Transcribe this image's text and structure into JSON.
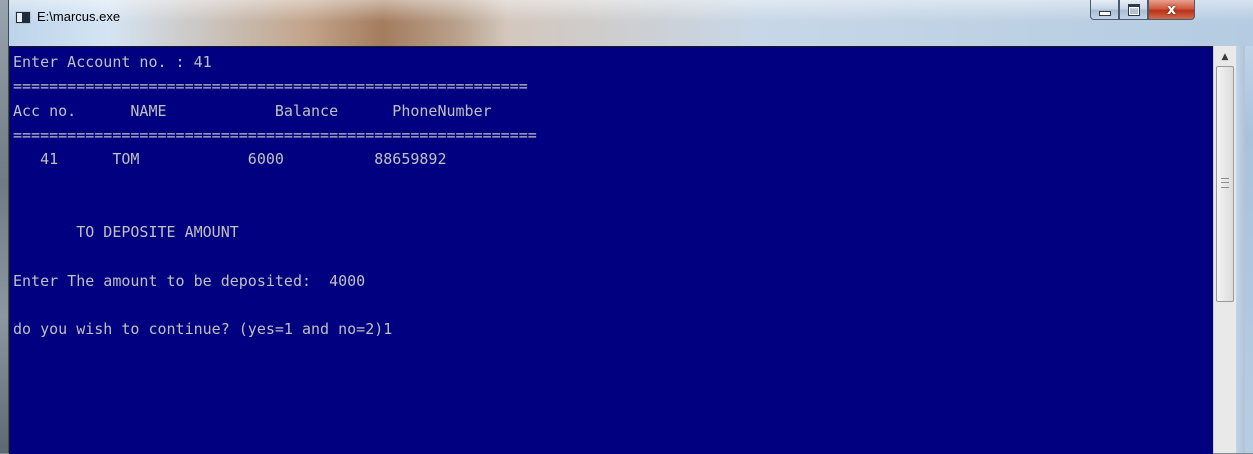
{
  "window": {
    "title": "E:\\marcus.exe",
    "buttons": [
      "minimize",
      "maximize",
      "close"
    ],
    "close_glyph": "x"
  },
  "console": {
    "background": "#000080",
    "foreground": "#c0c0c0",
    "lines": [
      "Enter Account no. : 41",
      "=========================================================",
      "Acc no.      NAME            Balance      PhoneNumber",
      "==========================================================",
      "   41      TOM            6000          88659892",
      "",
      "",
      "       TO DEPOSITE AMOUNT",
      "",
      "Enter The amount to be deposited:  4000",
      "",
      "do you wish to continue? (yes=1 and no=2)1",
      "",
      "",
      "",
      ""
    ]
  },
  "icons": {
    "app": "console-app-icon",
    "scroll_up": "up-arrow-icon",
    "grip": "scroll-grip-icon"
  }
}
